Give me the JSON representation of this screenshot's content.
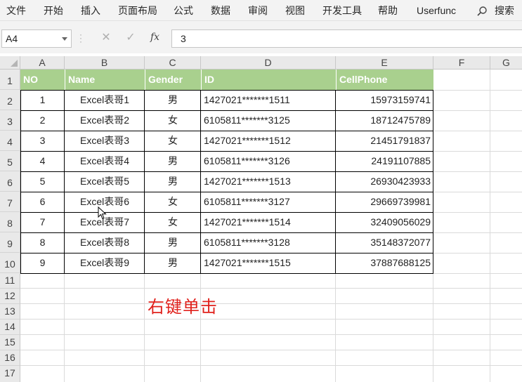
{
  "ribbon": {
    "tabs": [
      "文件",
      "开始",
      "插入",
      "页面布局",
      "公式",
      "数据",
      "审阅",
      "视图",
      "开发工具",
      "帮助",
      "Userfunc"
    ],
    "search_label": "搜索"
  },
  "formula_bar": {
    "name_box": "A4",
    "formula": "3",
    "fx_label": "fx"
  },
  "sheet": {
    "columns": [
      "A",
      "B",
      "C",
      "D",
      "E",
      "F",
      "G"
    ],
    "rows": [
      "1",
      "2",
      "3",
      "4",
      "5",
      "6",
      "7",
      "8",
      "9",
      "10",
      "11",
      "12",
      "13",
      "14",
      "15",
      "16",
      "17"
    ],
    "header_row": [
      "NO",
      "Name",
      "Gender",
      "ID",
      "CellPhone"
    ],
    "data": [
      [
        "1",
        "Excel表哥1",
        "男",
        "1427021*******1511",
        "15973159741"
      ],
      [
        "2",
        "Excel表哥2",
        "女",
        "6105811*******3125",
        "18712475789"
      ],
      [
        "3",
        "Excel表哥3",
        "女",
        "1427021*******1512",
        "21451791837"
      ],
      [
        "4",
        "Excel表哥4",
        "男",
        "6105811*******3126",
        "24191107885"
      ],
      [
        "5",
        "Excel表哥5",
        "男",
        "1427021*******1513",
        "26930423933"
      ],
      [
        "6",
        "Excel表哥6",
        "女",
        "6105811*******3127",
        "29669739981"
      ],
      [
        "7",
        "Excel表哥7",
        "女",
        "1427021*******1514",
        "32409056029"
      ],
      [
        "8",
        "Excel表哥8",
        "男",
        "6105811*******3128",
        "35148372077"
      ],
      [
        "9",
        "Excel表哥9",
        "男",
        "1427021*******1515",
        "37887688125"
      ]
    ],
    "annotation": "右键单击"
  },
  "colors": {
    "header_fill": "#a9d08e",
    "header_text": "#ffffff",
    "annotation": "#e0211c"
  }
}
